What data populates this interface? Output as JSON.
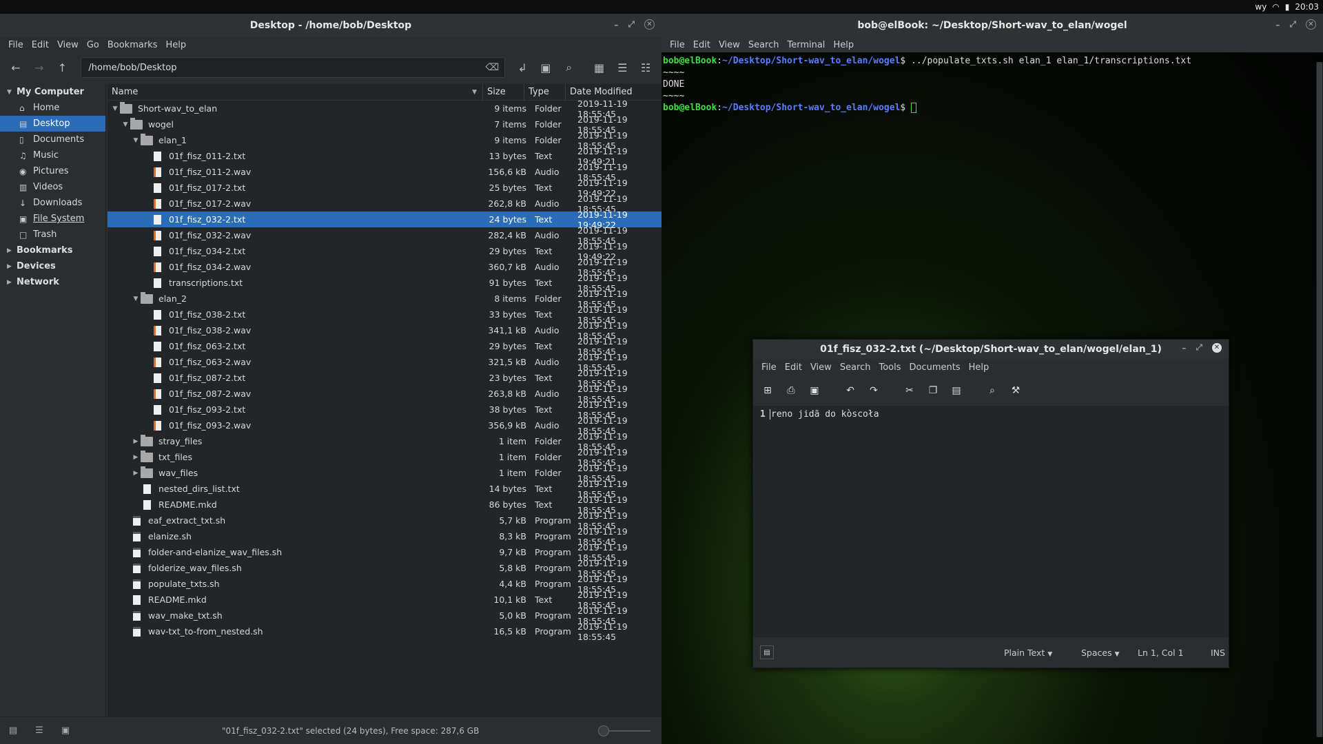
{
  "topbar": {
    "kb": "wy",
    "time": "20:03"
  },
  "fm": {
    "title": "Desktop - /home/bob/Desktop",
    "menu": [
      "File",
      "Edit",
      "View",
      "Go",
      "Bookmarks",
      "Help"
    ],
    "location": "/home/bob/Desktop",
    "sidebar": {
      "my_computer": "My Computer",
      "items": [
        {
          "label": "Home",
          "icon": "home-icon"
        },
        {
          "label": "Desktop",
          "icon": "desktop-icon"
        },
        {
          "label": "Documents",
          "icon": "documents-icon"
        },
        {
          "label": "Music",
          "icon": "music-icon"
        },
        {
          "label": "Pictures",
          "icon": "pictures-icon"
        },
        {
          "label": "Videos",
          "icon": "videos-icon"
        },
        {
          "label": "Downloads",
          "icon": "downloads-icon"
        },
        {
          "label": "File System",
          "icon": "filesystem-icon"
        },
        {
          "label": "Trash",
          "icon": "trash-icon"
        }
      ],
      "bookmarks": "Bookmarks",
      "devices": "Devices",
      "network": "Network"
    },
    "columns": {
      "name": "Name",
      "size": "Size",
      "type": "Type",
      "date": "Date Modified"
    },
    "rows": [
      {
        "name": "Short-wav_to_elan",
        "size": "9 items",
        "type": "Folder",
        "date": "2019-11-19 18:55:45",
        "depth": 0,
        "kind": "folder",
        "exp": "open"
      },
      {
        "name": "wogel",
        "size": "7 items",
        "type": "Folder",
        "date": "2019-11-19 18:55:45",
        "depth": 1,
        "kind": "folder",
        "exp": "open"
      },
      {
        "name": "elan_1",
        "size": "9 items",
        "type": "Folder",
        "date": "2019-11-19 18:55:45",
        "depth": 2,
        "kind": "folder",
        "exp": "open"
      },
      {
        "name": "01f_fisz_011-2.txt",
        "size": "13 bytes",
        "type": "Text",
        "date": "2019-11-19 19:49:21",
        "depth": 3,
        "kind": "doc"
      },
      {
        "name": "01f_fisz_011-2.wav",
        "size": "156,6 kB",
        "type": "Audio",
        "date": "2019-11-19 18:55:45",
        "depth": 3,
        "kind": "audio"
      },
      {
        "name": "01f_fisz_017-2.txt",
        "size": "25 bytes",
        "type": "Text",
        "date": "2019-11-19 19:49:22",
        "depth": 3,
        "kind": "doc"
      },
      {
        "name": "01f_fisz_017-2.wav",
        "size": "262,8 kB",
        "type": "Audio",
        "date": "2019-11-19 18:55:45",
        "depth": 3,
        "kind": "audio"
      },
      {
        "name": "01f_fisz_032-2.txt",
        "size": "24 bytes",
        "type": "Text",
        "date": "2019-11-19 19:49:22",
        "depth": 3,
        "kind": "doc",
        "selected": true
      },
      {
        "name": "01f_fisz_032-2.wav",
        "size": "282,4 kB",
        "type": "Audio",
        "date": "2019-11-19 18:55:45",
        "depth": 3,
        "kind": "audio"
      },
      {
        "name": "01f_fisz_034-2.txt",
        "size": "29 bytes",
        "type": "Text",
        "date": "2019-11-19 19:49:22",
        "depth": 3,
        "kind": "doc"
      },
      {
        "name": "01f_fisz_034-2.wav",
        "size": "360,7 kB",
        "type": "Audio",
        "date": "2019-11-19 18:55:45",
        "depth": 3,
        "kind": "audio"
      },
      {
        "name": "transcriptions.txt",
        "size": "91 bytes",
        "type": "Text",
        "date": "2019-11-19 18:55:45",
        "depth": 3,
        "kind": "doc"
      },
      {
        "name": "elan_2",
        "size": "8 items",
        "type": "Folder",
        "date": "2019-11-19 18:55:45",
        "depth": 2,
        "kind": "folder",
        "exp": "open"
      },
      {
        "name": "01f_fisz_038-2.txt",
        "size": "33 bytes",
        "type": "Text",
        "date": "2019-11-19 18:55:45",
        "depth": 3,
        "kind": "doc"
      },
      {
        "name": "01f_fisz_038-2.wav",
        "size": "341,1 kB",
        "type": "Audio",
        "date": "2019-11-19 18:55:45",
        "depth": 3,
        "kind": "audio"
      },
      {
        "name": "01f_fisz_063-2.txt",
        "size": "29 bytes",
        "type": "Text",
        "date": "2019-11-19 18:55:45",
        "depth": 3,
        "kind": "doc"
      },
      {
        "name": "01f_fisz_063-2.wav",
        "size": "321,5 kB",
        "type": "Audio",
        "date": "2019-11-19 18:55:45",
        "depth": 3,
        "kind": "audio"
      },
      {
        "name": "01f_fisz_087-2.txt",
        "size": "23 bytes",
        "type": "Text",
        "date": "2019-11-19 18:55:45",
        "depth": 3,
        "kind": "doc"
      },
      {
        "name": "01f_fisz_087-2.wav",
        "size": "263,8 kB",
        "type": "Audio",
        "date": "2019-11-19 18:55:45",
        "depth": 3,
        "kind": "audio"
      },
      {
        "name": "01f_fisz_093-2.txt",
        "size": "38 bytes",
        "type": "Text",
        "date": "2019-11-19 18:55:45",
        "depth": 3,
        "kind": "doc"
      },
      {
        "name": "01f_fisz_093-2.wav",
        "size": "356,9 kB",
        "type": "Audio",
        "date": "2019-11-19 18:55:45",
        "depth": 3,
        "kind": "audio"
      },
      {
        "name": "stray_files",
        "size": "1 item",
        "type": "Folder",
        "date": "2019-11-19 18:55:45",
        "depth": 2,
        "kind": "folder",
        "exp": "closed"
      },
      {
        "name": "txt_files",
        "size": "1 item",
        "type": "Folder",
        "date": "2019-11-19 18:55:45",
        "depth": 2,
        "kind": "folder",
        "exp": "closed"
      },
      {
        "name": "wav_files",
        "size": "1 item",
        "type": "Folder",
        "date": "2019-11-19 18:55:45",
        "depth": 2,
        "kind": "folder",
        "exp": "closed"
      },
      {
        "name": "nested_dirs_list.txt",
        "size": "14 bytes",
        "type": "Text",
        "date": "2019-11-19 18:55:45",
        "depth": 2,
        "kind": "doc"
      },
      {
        "name": "README.mkd",
        "size": "86 bytes",
        "type": "Text",
        "date": "2019-11-19 18:55:45",
        "depth": 2,
        "kind": "doc"
      },
      {
        "name": "eaf_extract_txt.sh",
        "size": "5,7 kB",
        "type": "Program",
        "date": "2019-11-19 18:55:45",
        "depth": 1,
        "kind": "prog"
      },
      {
        "name": "elanize.sh",
        "size": "8,3 kB",
        "type": "Program",
        "date": "2019-11-19 18:55:45",
        "depth": 1,
        "kind": "prog"
      },
      {
        "name": "folder-and-elanize_wav_files.sh",
        "size": "9,7 kB",
        "type": "Program",
        "date": "2019-11-19 18:55:45",
        "depth": 1,
        "kind": "prog"
      },
      {
        "name": "folderize_wav_files.sh",
        "size": "5,8 kB",
        "type": "Program",
        "date": "2019-11-19 18:55:45",
        "depth": 1,
        "kind": "prog"
      },
      {
        "name": "populate_txts.sh",
        "size": "4,4 kB",
        "type": "Program",
        "date": "2019-11-19 18:55:45",
        "depth": 1,
        "kind": "prog"
      },
      {
        "name": "README.mkd",
        "size": "10,1 kB",
        "type": "Text",
        "date": "2019-11-19 18:55:45",
        "depth": 1,
        "kind": "doc"
      },
      {
        "name": "wav_make_txt.sh",
        "size": "5,0 kB",
        "type": "Program",
        "date": "2019-11-19 18:55:45",
        "depth": 1,
        "kind": "prog"
      },
      {
        "name": "wav-txt_to-from_nested.sh",
        "size": "16,5 kB",
        "type": "Program",
        "date": "2019-11-19 18:55:45",
        "depth": 1,
        "kind": "prog"
      }
    ],
    "status": "\"01f_fisz_032-2.txt\" selected (24 bytes), Free space: 287,6 GB"
  },
  "term": {
    "title": "bob@elBook: ~/Desktop/Short-wav_to_elan/wogel",
    "menu": [
      "File",
      "Edit",
      "View",
      "Search",
      "Terminal",
      "Help"
    ],
    "user": "bob@elBook",
    "path": "~/Desktop/Short-wav_to_elan/wogel",
    "cmd": "../populate_txts.sh elan_1 elan_1/transcriptions.txt",
    "out1": "~~~~",
    "out2": "DONE",
    "out3": "~~~~"
  },
  "editor": {
    "title": "01f_fisz_032-2.txt (~/Desktop/Short-wav_to_elan/wogel/elan_1)",
    "menu": [
      "File",
      "Edit",
      "View",
      "Search",
      "Tools",
      "Documents",
      "Help"
    ],
    "line_no": "1",
    "text": "reno jidã do kòscoła",
    "syntax": "Plain Text",
    "indent": "Spaces",
    "position": "Ln 1, Col 1",
    "mode": "INS"
  },
  "colors": {
    "accent": "#2a6cb8",
    "prompt_green": "#3ee03e",
    "prompt_blue": "#5c7cfa"
  }
}
